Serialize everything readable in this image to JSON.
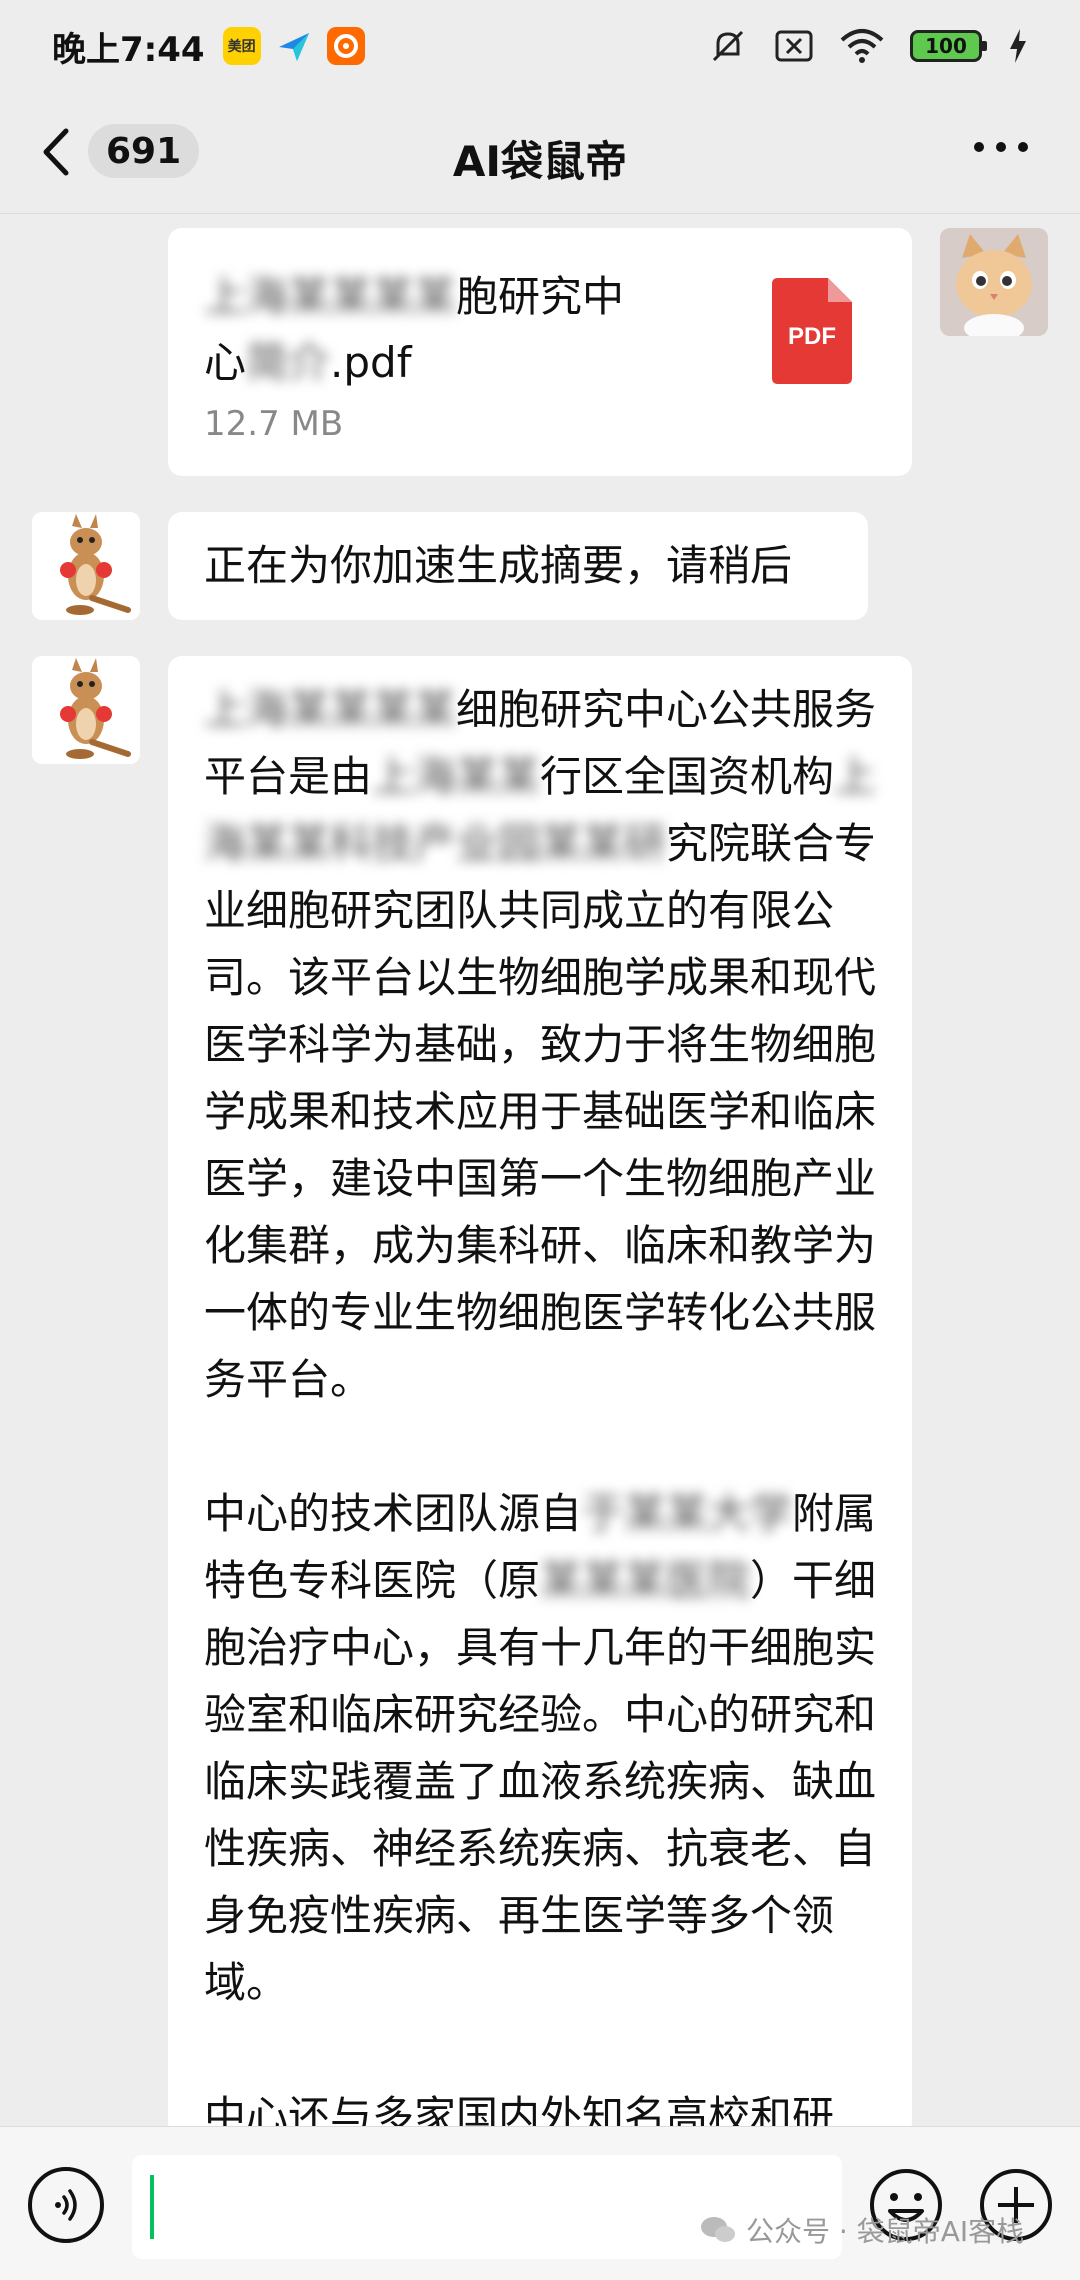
{
  "status_bar": {
    "time": "晚上7:44",
    "apps": [
      "美团",
      "飞书",
      "淘宝"
    ],
    "battery": "100"
  },
  "header": {
    "unread_count": "691",
    "title": "AI袋鼠帝"
  },
  "messages": {
    "file": {
      "name": "上海某某细胞研究中心简介.pdf",
      "name_visible_line1_prefix": "上海某某某某",
      "name_visible_line1": "胞研究中",
      "name_visible_line2_prefix": "心",
      "name_visible_line2_blur": "简介",
      "name_visible_line2_suffix": ".pdf",
      "size": "12.7 MB",
      "icon_label": "PDF"
    },
    "status_msg": "正在为你加速生成摘要，请稍后",
    "summary": {
      "p1_blur1": "上海某某某某",
      "p1a": "细胞研究中心公共服务平台是由",
      "p1_blur2": "上海某某",
      "p1b": "行区全国资机构",
      "p1_blur3": "上海某某科技产业园某某研",
      "p1c": "究院联合专业细胞研究团队共同成立的有限公司。该平台以生物细胞学成果和现代医学科学为基础，致力于将生物细胞学成果和技术应用于基础医学和临床医学，建设中国第一个生物细胞产业化集群，成为集科研、临床和教学为一体的专业生物细胞医学转化公共服务平台。",
      "p2a": "中心的技术团队源自",
      "p2_blur1": "于某某大学",
      "p2b": "附属特色专科医院（原",
      "p2_blur2": "某某某医院",
      "p2c": "）干细胞治疗中心，具有十几年的干细胞实验室和临床研究经验。中心的研究和临床实践覆盖了血液系统疾病、缺血性疾病、神经系统疾病、抗衰老、自身免疫性疾病、再生医学等多个领域。",
      "p3": "中心还与多家国内外知名高校和研"
    }
  },
  "watermark": "公众号 · 袋鼠帝AI客栈",
  "colors": {
    "background": "#ededed",
    "bubble": "#ffffff",
    "pdf_red": "#e53935",
    "cursor_green": "#07c160"
  }
}
